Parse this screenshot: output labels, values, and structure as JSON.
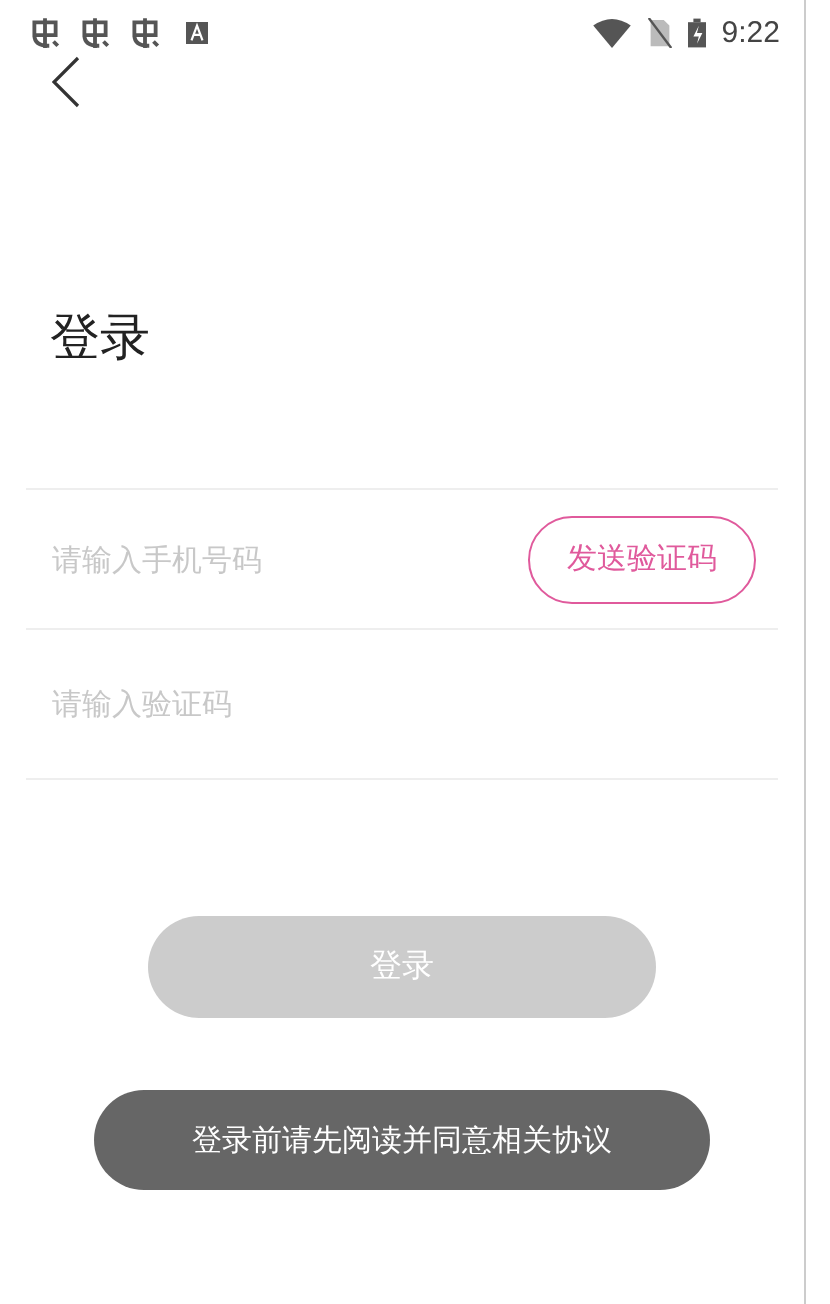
{
  "status_bar": {
    "time": "9:22"
  },
  "title": "登录",
  "form": {
    "phone_field": {
      "placeholder": "请输入手机号码"
    },
    "send_code_button": "发送验证码",
    "code_field": {
      "placeholder": "请输入验证码"
    }
  },
  "login_button": {
    "label": "登录",
    "disabled": true
  },
  "toast": "登录前请先阅读并同意相关协议"
}
